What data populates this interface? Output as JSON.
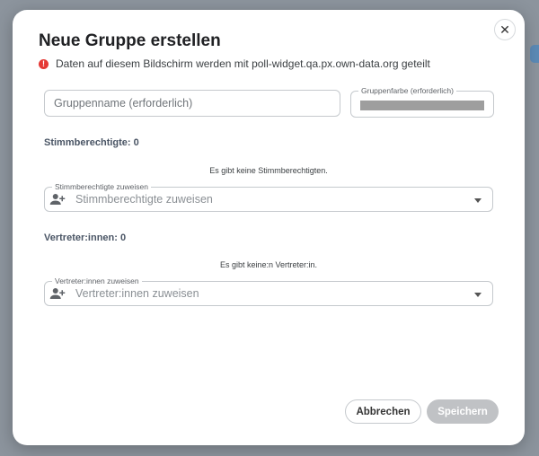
{
  "dialog": {
    "title": "Neue Gruppe erstellen",
    "close_glyph": "✕",
    "warning_icon_glyph": "!",
    "warning": "Daten auf diesem Bildschirm werden mit poll-widget.qa.px.own-data.org geteilt"
  },
  "form": {
    "group_name_placeholder": "Gruppenname (erforderlich)",
    "group_color_label": "Gruppenfarbe (erforderlich)",
    "group_color_value": "#9e9e9e"
  },
  "voters": {
    "heading": "Stimmberechtigte: 0",
    "empty_message": "Es gibt keine Stimmberechtigten.",
    "select_label": "Stimmberechtigte zuweisen",
    "select_placeholder": "Stimmberechtigte zuweisen",
    "icon": "person-add-icon"
  },
  "representatives": {
    "heading": "Vertreter:innen: 0",
    "empty_message": "Es gibt keine:n Vertreter:in.",
    "select_label": "Vertreter:innen zuweisen",
    "select_placeholder": "Vertreter:innen zuweisen",
    "icon": "person-add-icon"
  },
  "actions": {
    "cancel_label": "Abbrechen",
    "save_label": "Speichern"
  }
}
